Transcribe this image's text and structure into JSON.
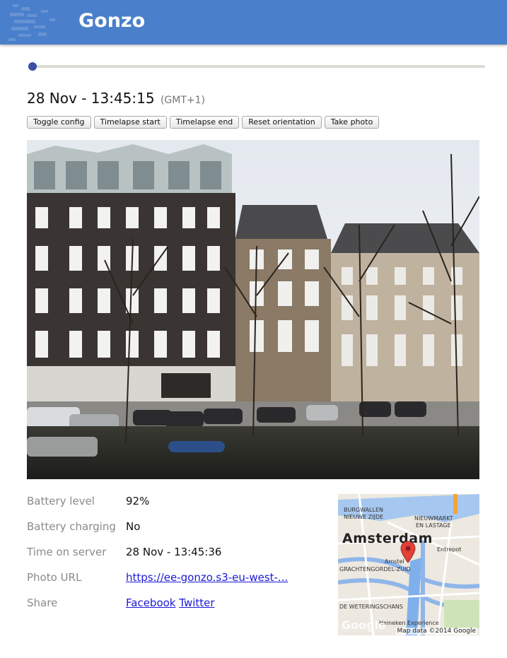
{
  "app": {
    "title": "Gonzo",
    "accent_color": "#4a7fcb"
  },
  "timeline": {
    "position": 0.0
  },
  "capture": {
    "date_time": "28 Nov - 13:45:15",
    "timezone": "(GMT+1)"
  },
  "toolbar": {
    "toggle_config": "Toggle config",
    "timelapse_start": "Timelapse start",
    "timelapse_end": "Timelapse end",
    "reset_orientation": "Reset orientation",
    "take_photo": "Take photo"
  },
  "info": {
    "battery_level_label": "Battery level",
    "battery_level_value": "92%",
    "battery_charging_label": "Battery charging",
    "battery_charging_value": "No",
    "server_time_label": "Time on server",
    "server_time_value": "28 Nov - 13:45:36",
    "photo_url_label": "Photo URL",
    "photo_url_value": "https://ee-gonzo.s3-eu-west-...",
    "share_label": "Share",
    "share_facebook": "Facebook",
    "share_twitter": "Twitter"
  },
  "map": {
    "city": "Amsterdam",
    "labels": {
      "burgwallen": "BURGWALLEN",
      "nieuwe_zijde": "NIEUWE ZIJDE",
      "nieuwmarkt": "NIEUWMARKT",
      "lastage": "EN LASTAGE",
      "entrepot": "Entrepot",
      "grachtengordel": "GRACHTENGORDEL-ZUID",
      "amstel": "Amstel",
      "weteringschans": "DE WETERINGSCHANS",
      "heineken": "Heineken Experience"
    },
    "google": "Google",
    "attribution": "Map data ©2014 Google",
    "marker_icon": "map-pin-icon",
    "marker_color": "#e0413a"
  }
}
